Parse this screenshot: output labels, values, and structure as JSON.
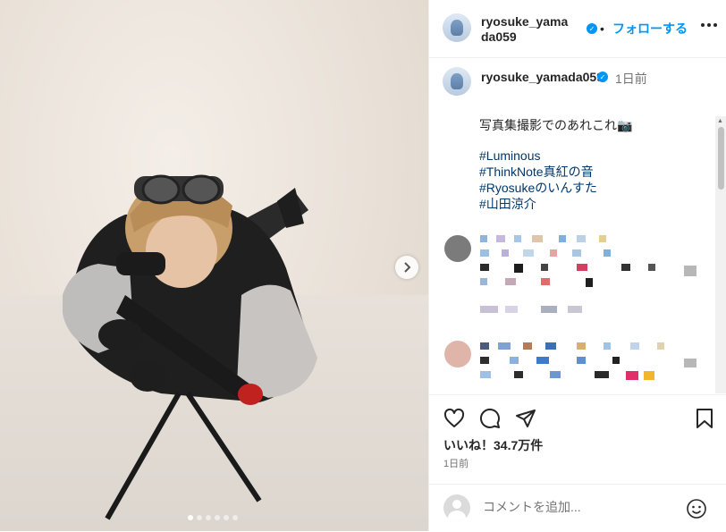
{
  "post": {
    "username": "ryosuke_yamada059",
    "header_username": "ryosuke_yamada059",
    "separator": "•",
    "follow_label": "フォローする",
    "time_ago": "1日前",
    "caption": "写真集撮影でのあれこれ📷",
    "hashtags": [
      "#Luminous",
      "#ThinkNote真紅の音",
      "#Ryosukeのいんすた",
      "#山田涼介"
    ],
    "likes_text": "いいね！34.7万件",
    "posted_ago": "1日前",
    "comment_placeholder": "コメントを追加...",
    "carousel_count": 6,
    "carousel_active_index": 0
  },
  "icons": [
    "next-arrow-icon",
    "more-icon",
    "verified-badge-icon",
    "heart-icon",
    "comment-icon",
    "share-icon",
    "bookmark-icon",
    "emoji-icon"
  ],
  "colors": {
    "accent": "#0095f6",
    "hashtag": "#00376b",
    "muted": "#737373",
    "text": "#262626"
  }
}
